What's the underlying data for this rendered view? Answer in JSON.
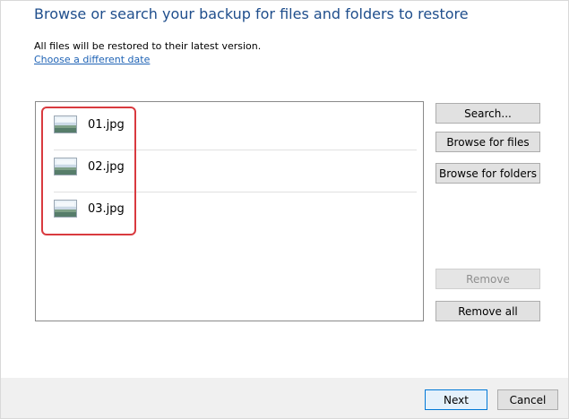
{
  "header": {
    "title": "Browse or search your backup for files and folders to restore",
    "subtitle": "All files will be restored to their latest version.",
    "link": "Choose a different date"
  },
  "files": [
    {
      "name": "01.jpg",
      "icon": "image-file-icon"
    },
    {
      "name": "02.jpg",
      "icon": "image-file-icon"
    },
    {
      "name": "03.jpg",
      "icon": "image-file-icon"
    }
  ],
  "side_buttons": {
    "search": "Search...",
    "browse_files": "Browse for files",
    "browse_folders": "Browse for folders",
    "remove": "Remove",
    "remove_all": "Remove all"
  },
  "footer": {
    "next": "Next",
    "cancel": "Cancel"
  },
  "colors": {
    "title": "#1f4e8c",
    "link": "#1f63b5",
    "highlight": "#d93a3f",
    "footer_bg": "#f0f0f0"
  }
}
